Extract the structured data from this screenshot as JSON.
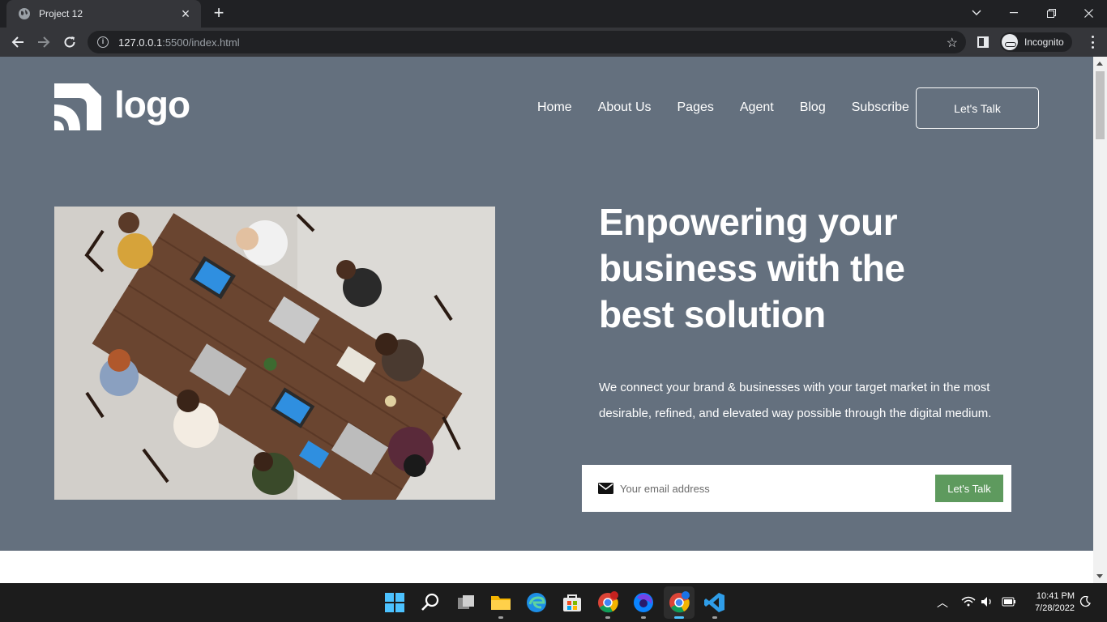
{
  "browser": {
    "tab_title": "Project 12",
    "url_host": "127.0.0.1",
    "url_path": ":5500/index.html",
    "incognito_label": "Incognito"
  },
  "site": {
    "logo_text": "logo",
    "nav": [
      {
        "label": "Home"
      },
      {
        "label": "About Us"
      },
      {
        "label": "Pages"
      },
      {
        "label": "Agent"
      },
      {
        "label": "Blog"
      },
      {
        "label": "Subscribe"
      }
    ],
    "cta_label": "Let's Talk",
    "headline": "Enpowering your business with the best solution",
    "subtext": "We connect your brand & businesses with your target market in the most desirable, refined, and elevated way possible through the digital medium.",
    "email_placeholder": "Your email address",
    "email_submit_label": "Let's Talk",
    "colors": {
      "hero_bg": "#64707e",
      "accent_green": "#5e9a5e"
    }
  },
  "taskbar": {
    "time": "10:41 PM",
    "date": "7/28/2022"
  }
}
